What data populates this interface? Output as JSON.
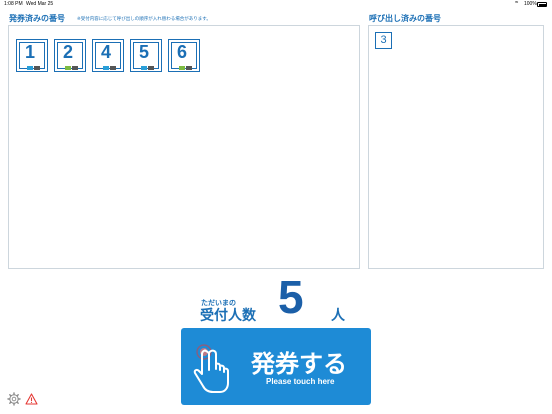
{
  "status_bar": {
    "time": "1:08 PM",
    "date": "Wed Mar 25",
    "battery": "100%"
  },
  "issued": {
    "title": "発券済みの番号",
    "note": "※受付内容に応じて呼び出しの順序が入れ替わる場合があります。",
    "tickets": [
      {
        "number": "1",
        "tag_color": "#2a9fd8"
      },
      {
        "number": "2",
        "tag_color": "#7dbb42"
      },
      {
        "number": "4",
        "tag_color": "#2a9fd8"
      },
      {
        "number": "5",
        "tag_color": "#2a9fd8"
      },
      {
        "number": "6",
        "tag_color": "#7dbb42"
      }
    ]
  },
  "called": {
    "title": "呼び出し済みの番号",
    "tickets": [
      "3"
    ]
  },
  "waiting": {
    "small_label": "ただいまの",
    "label": "受付人数",
    "count": "5",
    "unit": "人"
  },
  "issue_button": {
    "label": "発券する",
    "sublabel": "Please touch here",
    "icon": "hand-pointer-icon"
  },
  "footer": {
    "settings_icon": "gear-icon",
    "warning_icon": "warning-icon",
    "warning_color": "#e53935"
  },
  "colors": {
    "brand": "#1b6fb5",
    "button": "#1e8bd6"
  }
}
